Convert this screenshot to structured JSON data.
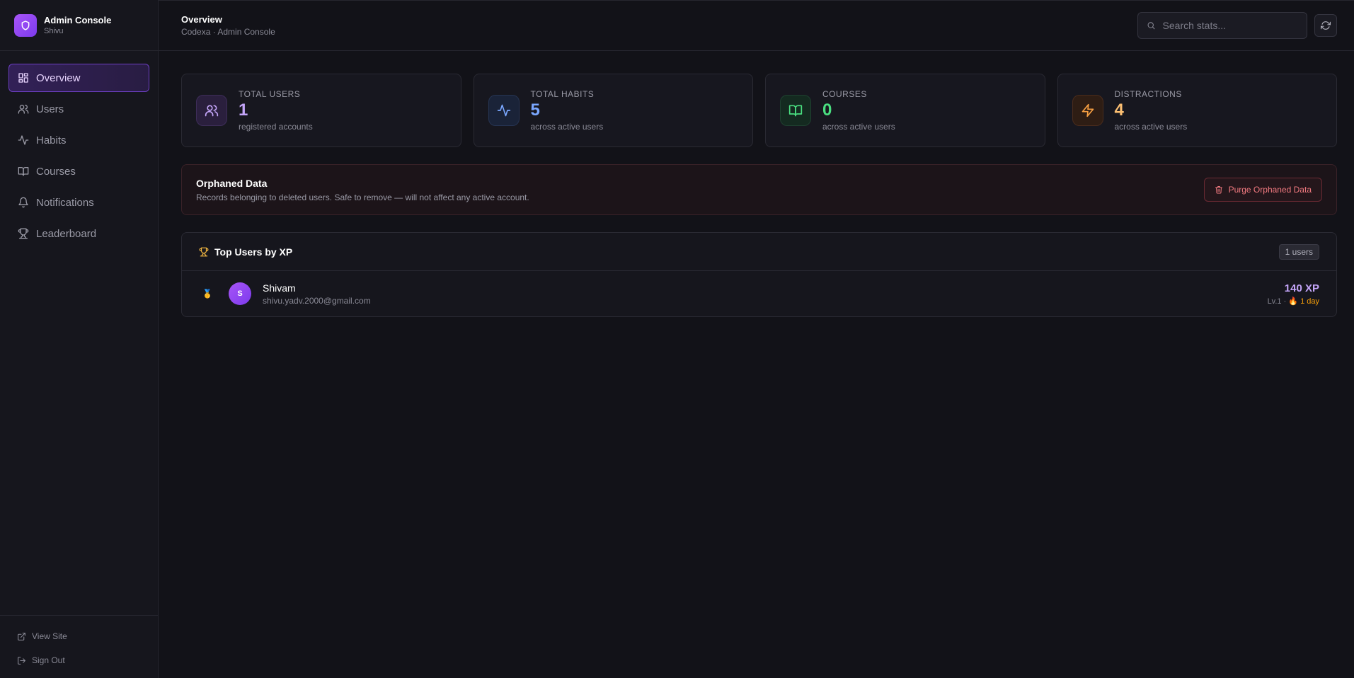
{
  "brand": {
    "title": "Admin Console",
    "subtitle": "Shivu"
  },
  "sidebar": {
    "items": [
      {
        "label": "Overview",
        "icon": "layout-grid-icon",
        "active": true
      },
      {
        "label": "Users",
        "icon": "users-icon"
      },
      {
        "label": "Habits",
        "icon": "activity-icon"
      },
      {
        "label": "Courses",
        "icon": "book-icon"
      },
      {
        "label": "Notifications",
        "icon": "bell-icon"
      },
      {
        "label": "Leaderboard",
        "icon": "trophy-icon"
      }
    ],
    "footer": [
      {
        "label": "View Site",
        "icon": "external-link-icon"
      },
      {
        "label": "Sign Out",
        "icon": "log-out-icon"
      }
    ]
  },
  "header": {
    "title": "Overview",
    "breadcrumb": "Codexa · Admin Console",
    "search_placeholder": "Search stats..."
  },
  "stats": [
    {
      "label": "TOTAL USERS",
      "value": "1",
      "sub": "registered accounts",
      "color": "#c4a5f9",
      "bg": "#2a1f3d",
      "border": "#3d2d58",
      "icon": "users-icon"
    },
    {
      "label": "TOTAL HABITS",
      "value": "5",
      "sub": "across active users",
      "color": "#7aa7ff",
      "bg": "#1a2338",
      "border": "#263452",
      "icon": "activity-icon"
    },
    {
      "label": "COURSES",
      "value": "0",
      "sub": "across active users",
      "color": "#4ade80",
      "bg": "#142a20",
      "border": "#1f4030",
      "icon": "book-icon"
    },
    {
      "label": "DISTRACTIONS",
      "value": "4",
      "sub": "across active users",
      "color": "#fbbf72",
      "bg": "#2e1d14",
      "border": "#4a2c1c",
      "icon": "zap-icon"
    }
  ],
  "orphan": {
    "title": "Orphaned Data",
    "description": "Records belonging to deleted users. Safe to remove — will not affect any active account.",
    "button": "Purge Orphaned Data"
  },
  "leaderboard": {
    "title": "Top Users by XP",
    "count": "1 users",
    "rows": [
      {
        "medal": "🥇",
        "initial": "S",
        "name": "Shivam",
        "email": "shivu.yadv.2000@gmail.com",
        "xp": "140 XP",
        "level": "Lv.1 ·",
        "streak": "🔥 1 day"
      }
    ]
  }
}
